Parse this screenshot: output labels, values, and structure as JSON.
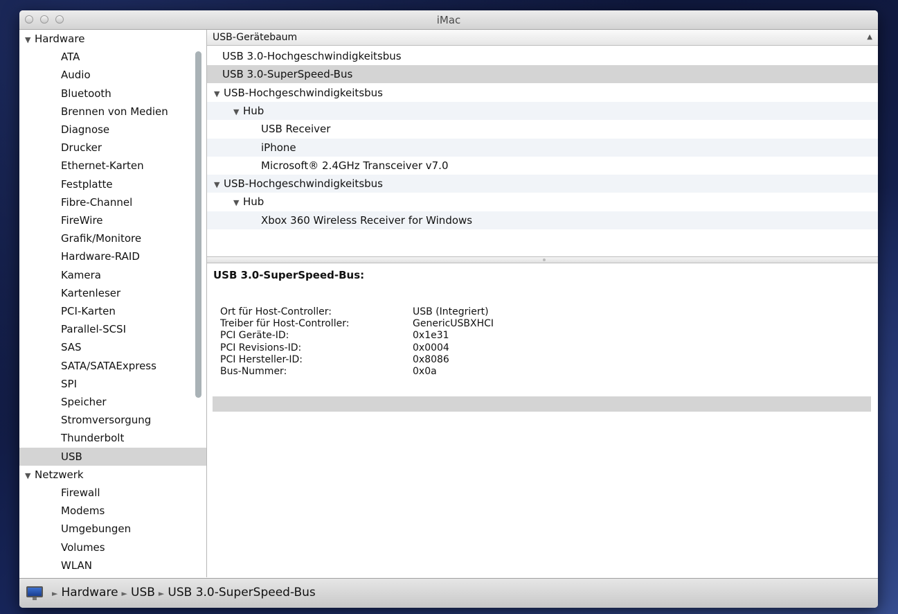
{
  "window": {
    "title": "iMac"
  },
  "sidebar": {
    "rows": [
      {
        "label": "Hardware",
        "kind": "cat"
      },
      {
        "label": "ATA",
        "kind": "sub"
      },
      {
        "label": "Audio",
        "kind": "sub"
      },
      {
        "label": "Bluetooth",
        "kind": "sub"
      },
      {
        "label": "Brennen von Medien",
        "kind": "sub"
      },
      {
        "label": "Diagnose",
        "kind": "sub"
      },
      {
        "label": "Drucker",
        "kind": "sub"
      },
      {
        "label": "Ethernet-Karten",
        "kind": "sub"
      },
      {
        "label": "Festplatte",
        "kind": "sub"
      },
      {
        "label": "Fibre-Channel",
        "kind": "sub"
      },
      {
        "label": "FireWire",
        "kind": "sub"
      },
      {
        "label": "Grafik/Monitore",
        "kind": "sub"
      },
      {
        "label": "Hardware-RAID",
        "kind": "sub"
      },
      {
        "label": "Kamera",
        "kind": "sub"
      },
      {
        "label": "Kartenleser",
        "kind": "sub"
      },
      {
        "label": "PCI-Karten",
        "kind": "sub"
      },
      {
        "label": "Parallel-SCSI",
        "kind": "sub"
      },
      {
        "label": "SAS",
        "kind": "sub"
      },
      {
        "label": "SATA/SATAExpress",
        "kind": "sub"
      },
      {
        "label": "SPI",
        "kind": "sub"
      },
      {
        "label": "Speicher",
        "kind": "sub"
      },
      {
        "label": "Stromversorgung",
        "kind": "sub"
      },
      {
        "label": "Thunderbolt",
        "kind": "sub"
      },
      {
        "label": "USB",
        "kind": "sub",
        "selected": true
      },
      {
        "label": "Netzwerk",
        "kind": "cat"
      },
      {
        "label": "Firewall",
        "kind": "sub"
      },
      {
        "label": "Modems",
        "kind": "sub"
      },
      {
        "label": "Umgebungen",
        "kind": "sub"
      },
      {
        "label": "Volumes",
        "kind": "sub"
      },
      {
        "label": "WLAN",
        "kind": "sub"
      }
    ]
  },
  "tree": {
    "header": "USB-Gerätebaum",
    "rows": [
      {
        "label": "USB 3.0-Hochgeschwindigkeitsbus",
        "level": 0,
        "expanded": false
      },
      {
        "label": "USB 3.0-SuperSpeed-Bus",
        "level": 0,
        "expanded": false,
        "selected": true
      },
      {
        "label": "USB-Hochgeschwindigkeitsbus",
        "level": 0,
        "expanded": true
      },
      {
        "label": "Hub",
        "level": 1,
        "expanded": true
      },
      {
        "label": "USB Receiver",
        "level": 2,
        "expanded": false
      },
      {
        "label": "iPhone",
        "level": 2,
        "expanded": false
      },
      {
        "label": "Microsoft® 2.4GHz Transceiver v7.0",
        "level": 2,
        "expanded": false
      },
      {
        "label": "USB-Hochgeschwindigkeitsbus",
        "level": 0,
        "expanded": true
      },
      {
        "label": "Hub",
        "level": 1,
        "expanded": true
      },
      {
        "label": "Xbox 360 Wireless Receiver for Windows",
        "level": 2,
        "expanded": false
      }
    ]
  },
  "detail": {
    "title": "USB 3.0-SuperSpeed-Bus:",
    "properties": [
      {
        "key": "Ort für Host-Controller:",
        "value": "USB (Integriert)"
      },
      {
        "key": "Treiber für Host-Controller:",
        "value": "GenericUSBXHCI"
      },
      {
        "key": "PCI Geräte-ID:",
        "value": "0x1e31"
      },
      {
        "key": "PCI Revisions-ID:",
        "value": "0x0004"
      },
      {
        "key": "PCI Hersteller-ID:",
        "value": "0x8086"
      },
      {
        "key": "Bus-Nummer:",
        "value": "0x0a"
      }
    ]
  },
  "statusbar": {
    "icon": "imac-icon",
    "path": [
      "Hardware",
      "USB",
      "USB 3.0-SuperSpeed-Bus"
    ]
  }
}
